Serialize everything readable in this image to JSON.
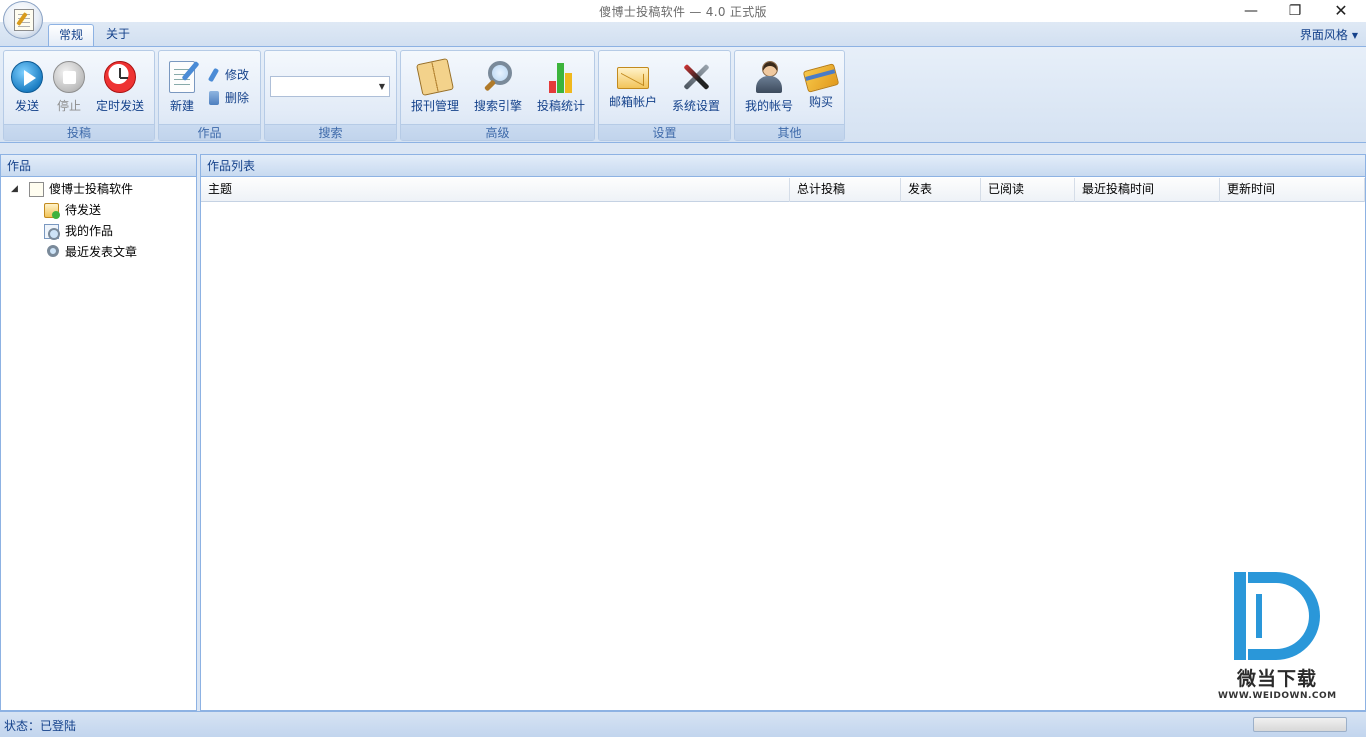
{
  "window": {
    "title": "傻博士投稿软件 — 4.0 正式版",
    "minimize": "—",
    "maximize": "❐",
    "close": "✕"
  },
  "tabs": [
    {
      "label": "常规",
      "active": true
    },
    {
      "label": "关于",
      "active": false
    }
  ],
  "style_menu": {
    "label": "界面风格",
    "caret": "▼"
  },
  "ribbon": {
    "groups": [
      {
        "label": "投稿",
        "buttons": [
          "发送",
          "停止",
          "定时发送"
        ]
      },
      {
        "label": "作品",
        "buttons": [
          "新建"
        ],
        "small_buttons": [
          "修改",
          "删除"
        ]
      },
      {
        "label": "搜索",
        "combo_value": "",
        "caret": "▼"
      },
      {
        "label": "高级",
        "buttons": [
          "报刊管理",
          "搜索引擎",
          "投稿统计"
        ]
      },
      {
        "label": "设置",
        "buttons": [
          "邮箱帐户",
          "系统设置"
        ]
      },
      {
        "label": "其他",
        "buttons": [
          "我的帐号",
          "购买"
        ]
      }
    ],
    "disabled": [
      "停止"
    ]
  },
  "left_panel": {
    "title": "作品",
    "tree": {
      "root": {
        "label": "傻博士投稿软件",
        "toggle": "◢"
      },
      "children": [
        "待发送",
        "我的作品",
        "最近发表文章"
      ]
    }
  },
  "right_panel": {
    "title": "作品列表",
    "columns": [
      "主题",
      "总计投稿",
      "发表",
      "已阅读",
      "最近投稿时间",
      "更新时间"
    ],
    "rows": []
  },
  "watermark": {
    "brand": "微当下载",
    "url": "WWW.WEIDOWN.COM",
    "color": "#2a97d9"
  },
  "status": {
    "text": "状态：已登陆"
  },
  "icons": [
    "play-icon",
    "stop-icon",
    "alarm-clock-icon",
    "new-document-icon",
    "edit-icon",
    "delete-icon",
    "newspaper-icon",
    "search-engine-icon",
    "bar-chart-icon",
    "mail-icon",
    "tools-icon",
    "user-icon",
    "credit-card-icon"
  ]
}
